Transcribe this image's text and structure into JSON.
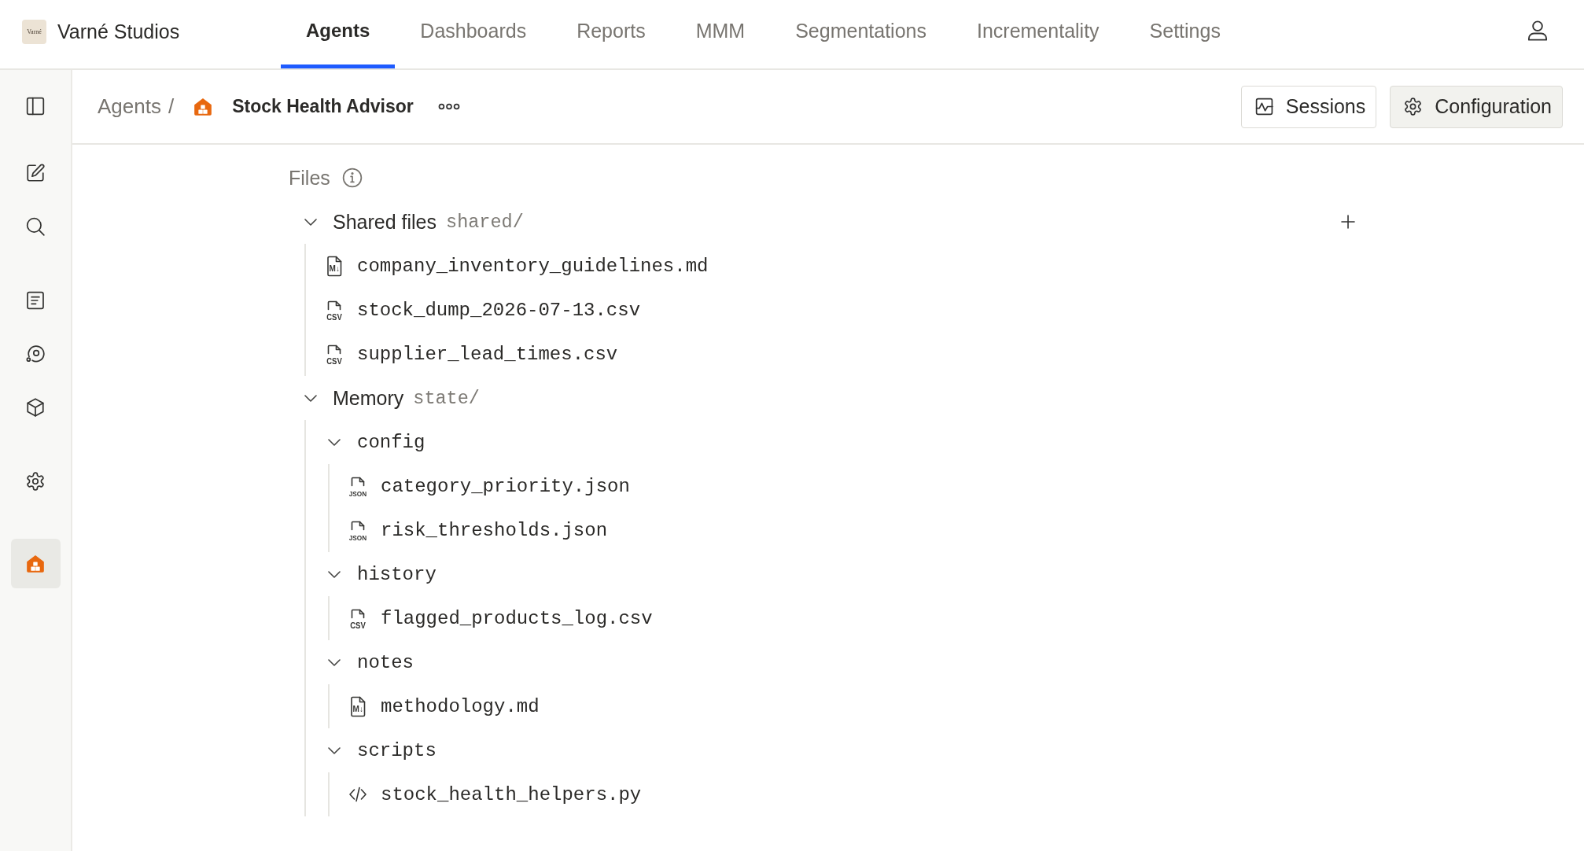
{
  "brand": {
    "logo_text": "Varné",
    "name": "Varné Studios"
  },
  "tabs": [
    {
      "label": "Agents",
      "selected": true
    },
    {
      "label": "Dashboards",
      "selected": false
    },
    {
      "label": "Reports",
      "selected": false
    },
    {
      "label": "MMM",
      "selected": false
    },
    {
      "label": "Segmentations",
      "selected": false
    },
    {
      "label": "Incrementality",
      "selected": false
    },
    {
      "label": "Settings",
      "selected": false
    }
  ],
  "sidebar": {
    "groups": [
      {
        "items": [
          {
            "selected": false
          },
          {
            "selected": false
          }
        ]
      },
      {
        "items": [
          {
            "selected": false
          },
          {
            "selected": false
          },
          {
            "selected": false
          }
        ]
      },
      {
        "items": [
          {
            "selected": false
          }
        ]
      },
      {
        "items": [
          {
            "selected": true
          }
        ]
      }
    ]
  },
  "header": {
    "breadcrumb": {
      "parent": "Agents",
      "separator": "/",
      "current": "Stock Health Advisor"
    },
    "buttons": [
      {
        "label": "Sessions",
        "selected": false
      },
      {
        "label": "Configuration",
        "selected": true
      }
    ]
  },
  "files": {
    "title": "Files",
    "groups": [
      {
        "label": "Shared files",
        "path": "shared/",
        "expanded": true,
        "addable": true,
        "children": [
          {
            "kind": "markdown",
            "icon_label": "M↓",
            "name": "company_inventory_guidelines.md"
          },
          {
            "kind": "csv",
            "icon_label": "CSV",
            "name": "stock_dump_2026-07-13.csv"
          },
          {
            "kind": "csv",
            "icon_label": "CSV",
            "name": "supplier_lead_times.csv"
          }
        ]
      },
      {
        "label": "Memory",
        "path": "state/",
        "expanded": true,
        "addable": false,
        "children": [
          {
            "kind": "folder",
            "name": "config",
            "expanded": true,
            "children": [
              {
                "kind": "json",
                "icon_label": "JSON",
                "name": "category_priority.json"
              },
              {
                "kind": "json",
                "icon_label": "JSON",
                "name": "risk_thresholds.json"
              }
            ]
          },
          {
            "kind": "folder",
            "name": "history",
            "expanded": true,
            "children": [
              {
                "kind": "csv",
                "icon_label": "CSV",
                "name": "flagged_products_log.csv"
              }
            ]
          },
          {
            "kind": "folder",
            "name": "notes",
            "expanded": true,
            "children": [
              {
                "kind": "markdown",
                "icon_label": "M↓",
                "name": "methodology.md"
              }
            ]
          },
          {
            "kind": "folder",
            "name": "scripts",
            "expanded": true,
            "children": [
              {
                "kind": "code",
                "name": "stock_health_helpers.py"
              }
            ]
          }
        ]
      }
    ]
  }
}
